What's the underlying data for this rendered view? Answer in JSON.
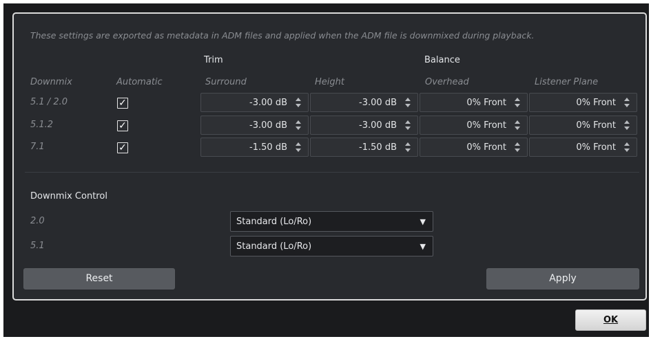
{
  "info_text": "These settings are exported as metadata in ADM files and applied when the ADM file is downmixed during playback.",
  "groups": {
    "trim": "Trim",
    "balance": "Balance"
  },
  "columns": {
    "downmix": "Downmix",
    "automatic": "Automatic",
    "surround": "Surround",
    "height": "Height",
    "overhead": "Overhead",
    "listener_plane": "Listener Plane"
  },
  "rows": [
    {
      "label": "5.1 / 2.0",
      "automatic": true,
      "surround": "-3.00 dB",
      "height": "-3.00 dB",
      "overhead": "0% Front",
      "listener_plane": "0% Front"
    },
    {
      "label": "5.1.2",
      "automatic": true,
      "surround": "-3.00 dB",
      "height": "-3.00 dB",
      "overhead": "0% Front",
      "listener_plane": "0% Front"
    },
    {
      "label": "7.1",
      "automatic": true,
      "surround": "-1.50 dB",
      "height": "-1.50 dB",
      "overhead": "0% Front",
      "listener_plane": "0% Front"
    }
  ],
  "check_mark": "✓",
  "downmix_control": {
    "title": "Downmix Control",
    "items": [
      {
        "label": "2.0",
        "value": "Standard (Lo/Ro)"
      },
      {
        "label": "5.1",
        "value": "Standard (Lo/Ro)"
      }
    ],
    "caret": "▼"
  },
  "buttons": {
    "reset": "Reset",
    "apply": "Apply",
    "ok": "OK"
  }
}
